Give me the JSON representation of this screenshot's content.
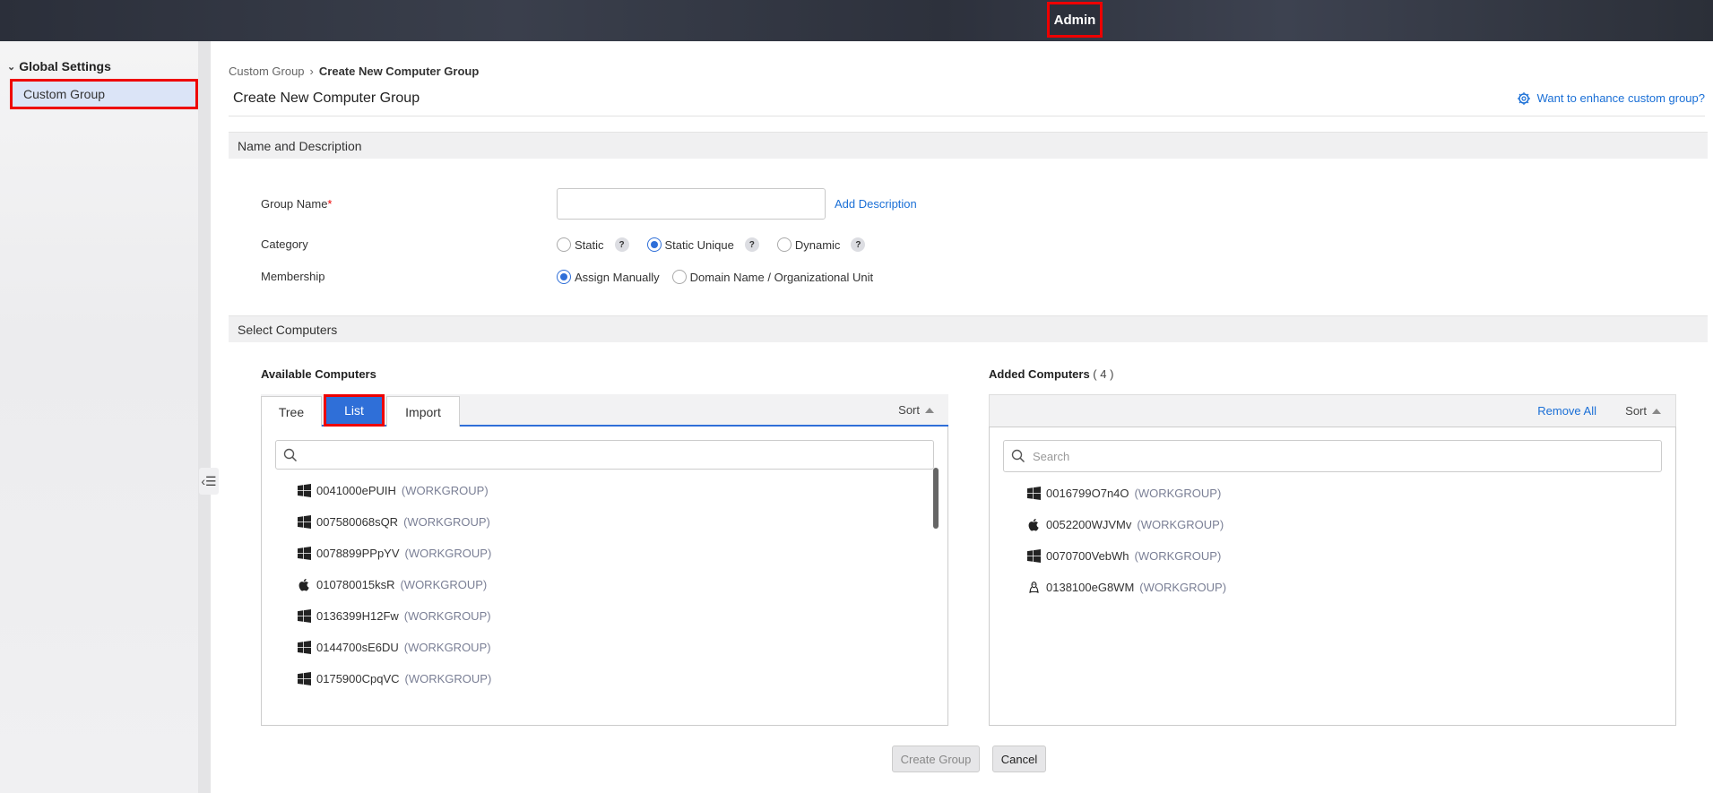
{
  "topbar": {
    "admin_label": "Admin"
  },
  "sidebar": {
    "section_label": "Global Settings",
    "items": [
      {
        "label": "Custom Group",
        "selected": true
      }
    ]
  },
  "breadcrumb": {
    "parent": "Custom Group",
    "current": "Create New Computer Group"
  },
  "page": {
    "title": "Create New Computer Group",
    "enhance_link": "Want to enhance custom group?"
  },
  "name_section": {
    "title": "Name and Description",
    "group_name_label": "Group Name",
    "required_mark": "*",
    "group_name_value": "",
    "add_description": "Add Description",
    "category_label": "Category",
    "category_options": [
      "Static",
      "Static Unique",
      "Dynamic"
    ],
    "category_selected": "Static Unique",
    "help_glyph": "?",
    "membership_label": "Membership",
    "membership_options": [
      "Assign Manually",
      "Domain Name / Organizational Unit"
    ],
    "membership_selected": "Assign Manually"
  },
  "select_section": {
    "title": "Select Computers",
    "available": {
      "title": "Available Computers",
      "tabs": [
        "Tree",
        "List",
        "Import"
      ],
      "active_tab": "List",
      "sort_label": "Sort",
      "search_placeholder": "",
      "computers": [
        {
          "name": "0041000ePUIH",
          "group": "(WORKGROUP)",
          "os": "windows-icon"
        },
        {
          "name": "007580068sQR",
          "group": "(WORKGROUP)",
          "os": "windows-icon"
        },
        {
          "name": "0078899PPpYV",
          "group": "(WORKGROUP)",
          "os": "windows-icon"
        },
        {
          "name": "010780015ksR",
          "group": "(WORKGROUP)",
          "os": "apple-icon"
        },
        {
          "name": "0136399H12Fw",
          "group": "(WORKGROUP)",
          "os": "windows-icon"
        },
        {
          "name": "0144700sE6DU",
          "group": "(WORKGROUP)",
          "os": "windows-icon"
        },
        {
          "name": "0175900CpqVC",
          "group": "(WORKGROUP)",
          "os": "windows-icon"
        }
      ]
    },
    "added": {
      "title": "Added Computers",
      "count": "( 4 )",
      "remove_all": "Remove All",
      "sort_label": "Sort",
      "search_placeholder": "Search",
      "computers": [
        {
          "name": "0016799O7n4O",
          "group": "(WORKGROUP)",
          "os": "windows-icon"
        },
        {
          "name": "0052200WJVMv",
          "group": "(WORKGROUP)",
          "os": "apple-icon"
        },
        {
          "name": "0070700VebWh",
          "group": "(WORKGROUP)",
          "os": "windows-icon"
        },
        {
          "name": "0138100eG8WM",
          "group": "(WORKGROUP)",
          "os": "linux-icon"
        }
      ]
    }
  },
  "actions": {
    "create": "Create Group",
    "cancel": "Cancel"
  },
  "colors": {
    "accent": "#2f6fd8",
    "link": "#1a6fd6",
    "highlight": "#ee0000"
  }
}
